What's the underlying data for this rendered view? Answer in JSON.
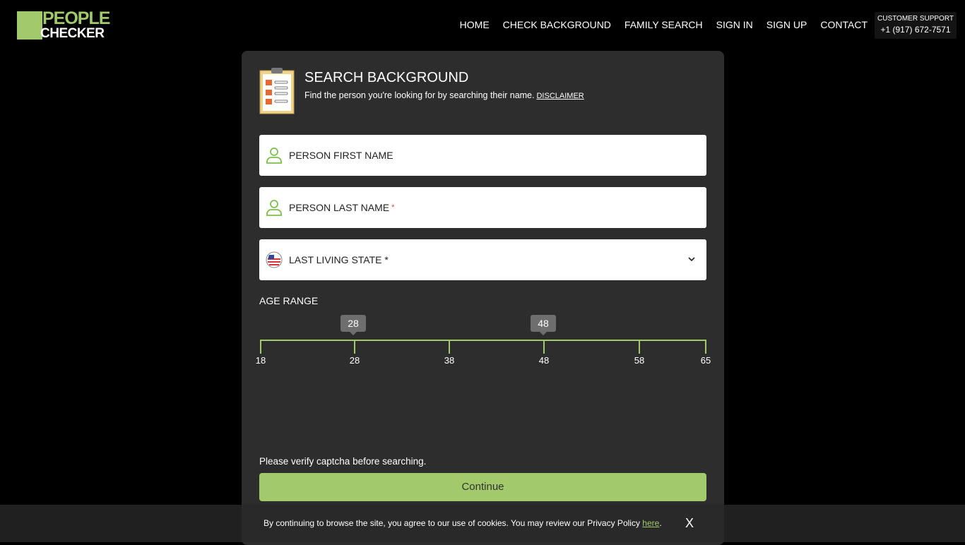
{
  "brand": {
    "line1": "PEOPLE",
    "line2": "CHECKER",
    "color": "#a2c96a"
  },
  "nav": [
    "HOME",
    "CHECK BACKGROUND",
    "FAMILY SEARCH",
    "SIGN IN",
    "SIGN UP",
    "CONTACT"
  ],
  "support": {
    "title": "CUSTOMER SUPPORT",
    "phone": "+1 (917) 672-7571"
  },
  "form": {
    "title": "SEARCH BACKGROUND",
    "subtitle": "Find the person you're looking for by searching their name.",
    "disclaimer": "DISCLAIMER",
    "first_name": "PERSON FIRST NAME",
    "last_name": "PERSON LAST NAME",
    "required_mark": "*",
    "state": "LAST LIVING STATE *",
    "age_label": "AGE RANGE",
    "age_min": "28",
    "age_max": "48",
    "ticks": [
      "18",
      "28",
      "38",
      "48",
      "58",
      "65"
    ],
    "captcha_msg": "Please verify captcha before searching.",
    "continue": "Continue"
  },
  "cookie": {
    "text": "By continuing to browse the site, you agree to our use of cookies. You may review our Privacy Policy",
    "link": "here",
    "close": "X"
  }
}
